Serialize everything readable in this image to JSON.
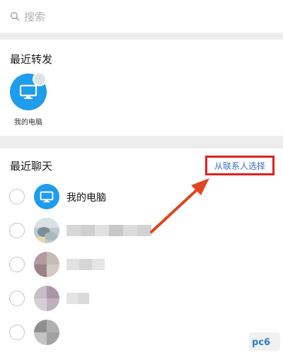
{
  "search": {
    "placeholder": "搜索",
    "icon": "search-icon"
  },
  "recent_forward": {
    "title": "最近转发",
    "items": [
      {
        "label": "我的电脑",
        "icon": "computer-icon"
      }
    ]
  },
  "recent_chats": {
    "title": "最近聊天",
    "select_from_contacts": "从联系人选择",
    "rows": [
      {
        "name": "我的电脑",
        "avatar": "computer-icon"
      },
      {
        "name": "",
        "avatar": "photo-avatar"
      },
      {
        "name": "",
        "avatar": "pixelated-avatar"
      },
      {
        "name": "",
        "avatar": "pixelated-avatar"
      },
      {
        "name": "",
        "avatar": "pixelated-avatar"
      }
    ]
  },
  "colors": {
    "accent_blue": "#1f9cec",
    "link_blue": "#3b6fc7",
    "highlight_red": "#e02020"
  },
  "watermark": {
    "text": "pc6"
  }
}
